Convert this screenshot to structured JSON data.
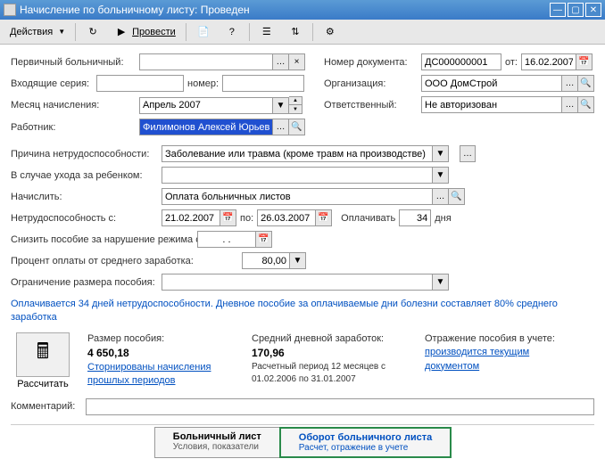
{
  "window": {
    "title": "Начисление по больничному листу: Проведен"
  },
  "toolbar": {
    "actions": "Действия",
    "process": "Провести"
  },
  "labels": {
    "primary_sick": "Первичный больничный:",
    "incoming_series": "Входящие серия:",
    "number": "номер:",
    "accrual_month": "Месяц начисления:",
    "employee": "Работник:",
    "doc_number": "Номер документа:",
    "from": "от:",
    "organization": "Организация:",
    "responsible": "Ответственный:",
    "disability_reason": "Причина нетрудоспособности:",
    "child_care": "В случае ухода за ребенком:",
    "accrue": "Начислить:",
    "disability_from": "Нетрудоспособность с:",
    "to": "по:",
    "pay": "Оплачивать",
    "days": "дня",
    "reduce_benefit": "Снизить пособие за нарушение режима с:",
    "percent_pay": "Процент оплаты от среднего заработка:",
    "benefit_limit": "Ограничение размера пособия:",
    "comment": "Комментарий:"
  },
  "values": {
    "month": "Апрель 2007",
    "employee": "Филимонов Алексей Юрьеви",
    "doc_number": "ДС000000001",
    "date": "16.02.2007",
    "organization": "ООО ДомСтрой",
    "responsible": "Не авторизован",
    "reason": "Заболевание или травма (кроме травм на производстве)",
    "accrue": "Оплата больничных листов",
    "date_from": "21.02.2007",
    "date_to": "26.03.2007",
    "days": "34",
    "reduce_date": ". .",
    "percent": "80,00"
  },
  "info": {
    "paid_text": "Оплачивается 34 дней нетрудоспособности. Дневное пособие за оплачиваемые дни болезни составляет 80% среднего заработка"
  },
  "calc": {
    "button": "Рассчитать",
    "size_label": "Размер пособия:",
    "size_value": "4 650,18",
    "cancel_link": "Сторнированы начисления прошлых периодов",
    "avg_label": "Средний дневной заработок:",
    "avg_value": "170,96",
    "period": "Расчетный период 12 месяцев с 01.02.2006 по 31.01.2007",
    "reflect_label": "Отражение пособия в учете:",
    "reflect_value": "производится текущим документом"
  },
  "tabs": {
    "tab1_title": "Больничный лист",
    "tab1_sub": "Условия, показатели",
    "tab2_title": "Оборот больничного листа",
    "tab2_sub": "Расчет, отражение в учете"
  }
}
